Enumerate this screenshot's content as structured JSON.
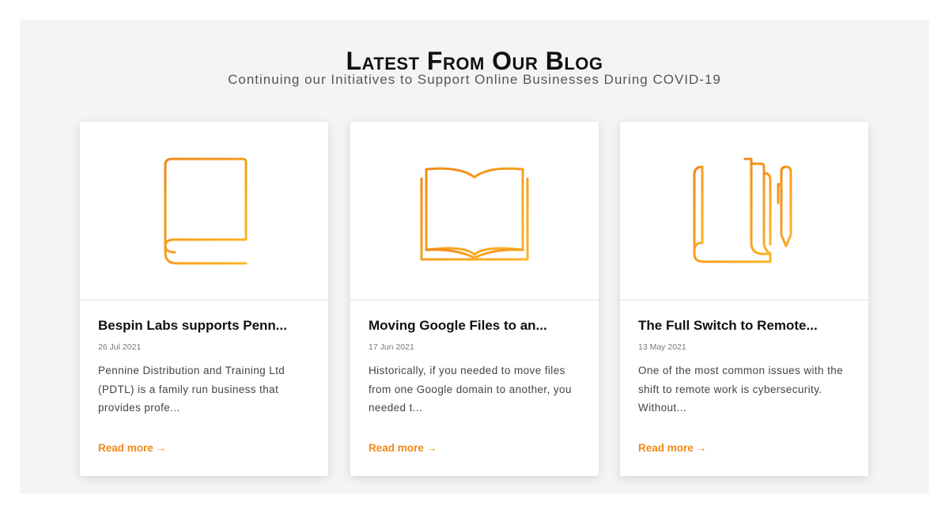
{
  "section": {
    "title": "Latest From Our Blog",
    "subtitle": "Continuing our Initiatives to Support Online Businesses During COVID-19"
  },
  "colors": {
    "accent": "#f08a18",
    "icon_gradient_start": "#f08a18",
    "icon_gradient_end": "#fbb528",
    "section_bg": "#f4f4f4"
  },
  "posts": [
    {
      "icon": "closed-book-icon",
      "title": "Bespin Labs supports Penn...",
      "date": "26 Jul 2021",
      "excerpt": "Pennine Distribution and Training Ltd (PDTL) is a family run business that provides profe...",
      "read_more": "Read more",
      "arrow": "→"
    },
    {
      "icon": "open-book-icon",
      "title": "Moving Google Files to an...",
      "date": "17 Jun 2021",
      "excerpt": "Historically, if you needed to move files from one Google domain to another, you needed t...",
      "read_more": "Read more",
      "arrow": "→"
    },
    {
      "icon": "notebook-pen-icon",
      "title": "The Full Switch to Remote...",
      "date": "13 May 2021",
      "excerpt": "One of the most common issues with the shift to remote work is cybersecurity. Without...",
      "read_more": "Read more",
      "arrow": "→"
    }
  ]
}
